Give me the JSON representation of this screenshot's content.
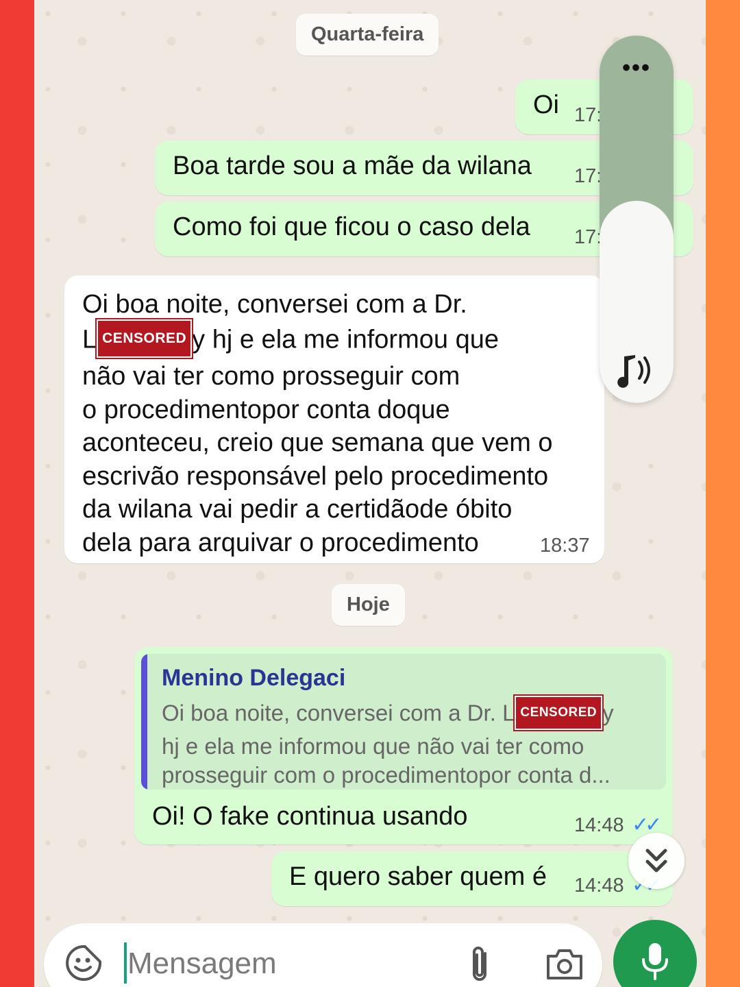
{
  "colors": {
    "outgoing_bubble": "#d9fdd3",
    "incoming_bubble": "#ffffff",
    "read_ticks": "#3b87f0",
    "mic_button": "#1f9a4e",
    "quote_bar": "#5b4fd6",
    "censor_label": "#b3171f"
  },
  "chat": {
    "date_wed": "Quarta-feira",
    "date_today": "Hoje",
    "censor_label": "CENSORED",
    "messages": [
      {
        "text": "Oi",
        "time": "17:"
      },
      {
        "text": "Boa tarde sou a mãe  da wilana",
        "time": "17:"
      },
      {
        "text": "Como foi que ficou o caso dela",
        "time": "17:"
      }
    ],
    "incoming": {
      "line1": "Oi boa noite, conversei com a Dr.",
      "line2_prefix": "L",
      "line2_suffix": "y hj e ela me informou que",
      "line3": "não vai ter como prosseguir com",
      "line4": "o procedimentopor conta doque",
      "line5": "aconteceu, creio que semana que vem o",
      "line6": "escrivão responsável pelo procedimento",
      "line7": "da wilana vai pedir a certidãode óbito",
      "line8": "dela para arquivar o procedimento",
      "time": "18:37"
    },
    "reply": {
      "quote_author": "Menino Delegaci",
      "quote_line1_prefix": "Oi boa noite, conversei com a Dr. L",
      "quote_line1_suffix": "y",
      "quote_line2": "hj e ela me informou que não vai ter como",
      "quote_line3": "prosseguir com o procedimentopor conta d...",
      "text": "Oi! O fake continua usando",
      "time": "14:48",
      "ticks": "✓✓"
    },
    "last": {
      "text": "E quero saber quem é",
      "time": "14:48",
      "ticks": "✓✓"
    }
  },
  "volume_overlay": {
    "menu_label": "•••",
    "level": 0.55,
    "icon": "speaker-icon"
  },
  "composer": {
    "placeholder": "Mensagem",
    "emoji_icon": "sticker-emoji-icon",
    "attach_icon": "paperclip-icon",
    "camera_icon": "camera-icon",
    "mic_icon": "microphone-icon"
  }
}
